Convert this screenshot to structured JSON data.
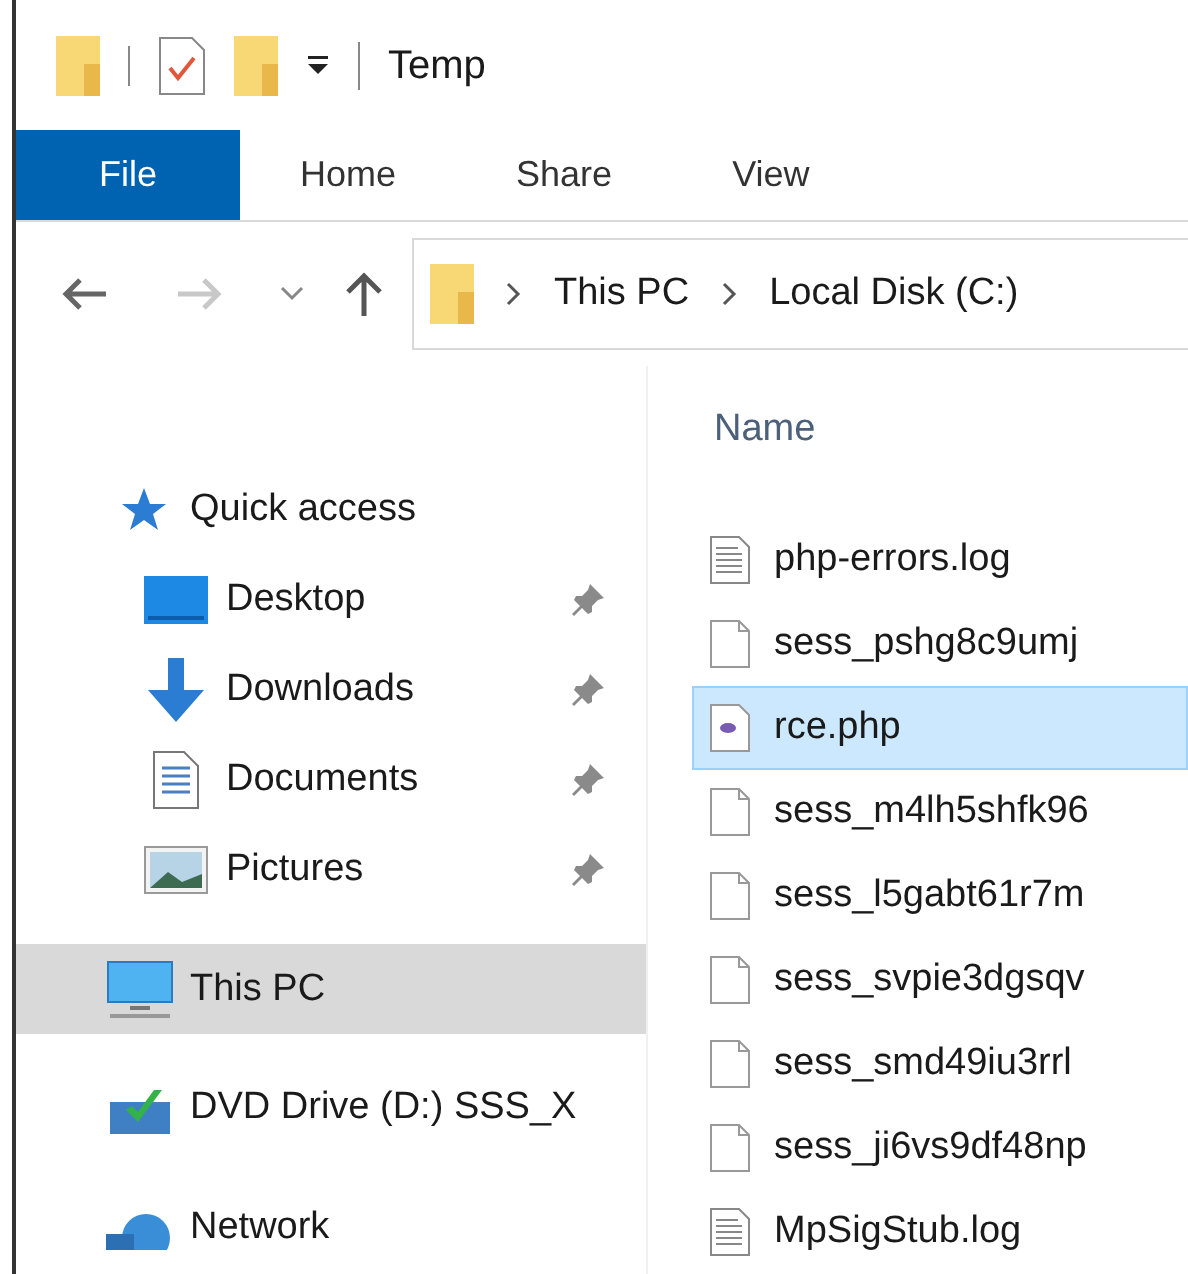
{
  "title_bar": {
    "title": "Temp"
  },
  "ribbon_tabs": [
    {
      "label": "File",
      "selected": true
    },
    {
      "label": "Home",
      "selected": false
    },
    {
      "label": "Share",
      "selected": false
    },
    {
      "label": "View",
      "selected": false
    }
  ],
  "address_bar": {
    "crumbs": [
      "This PC",
      "Local Disk (C:)"
    ]
  },
  "navigation": [
    {
      "label": "Quick access",
      "kind": "star",
      "selected": false,
      "children": [
        {
          "label": "Desktop",
          "kind": "desktop",
          "pinned": true,
          "selected": false
        },
        {
          "label": "Downloads",
          "kind": "download",
          "pinned": true,
          "selected": false
        },
        {
          "label": "Documents",
          "kind": "document",
          "pinned": true,
          "selected": false
        },
        {
          "label": "Pictures",
          "kind": "pictures",
          "pinned": true,
          "selected": false
        }
      ]
    },
    {
      "label": "This PC",
      "kind": "computer",
      "selected": true
    },
    {
      "label": "DVD Drive (D:) SSS_X",
      "kind": "dvd",
      "selected": false
    },
    {
      "label": "Network",
      "kind": "network",
      "selected": false
    }
  ],
  "file_list": {
    "column": "Name",
    "rows": [
      {
        "name": "php-errors.log",
        "kind": "text",
        "selected": false
      },
      {
        "name": "sess_pshg8c9umj",
        "kind": "blank",
        "selected": false
      },
      {
        "name": "rce.php",
        "kind": "php",
        "selected": true
      },
      {
        "name": "sess_m4lh5shfk96",
        "kind": "blank",
        "selected": false
      },
      {
        "name": "sess_l5gabt61r7m",
        "kind": "blank",
        "selected": false
      },
      {
        "name": "sess_svpie3dgsqv",
        "kind": "blank",
        "selected": false
      },
      {
        "name": "sess_smd49iu3rrl",
        "kind": "blank",
        "selected": false
      },
      {
        "name": "sess_ji6vs9df48np",
        "kind": "blank",
        "selected": false
      },
      {
        "name": "MpSigStub.log",
        "kind": "text",
        "selected": false
      }
    ]
  }
}
